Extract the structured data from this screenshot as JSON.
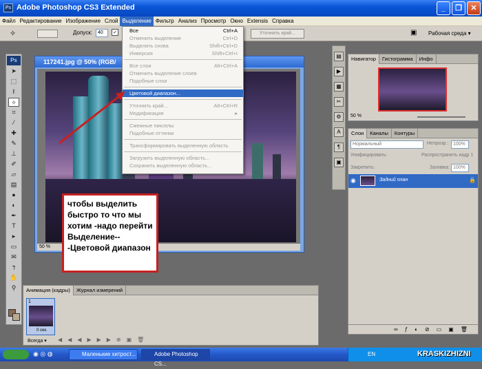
{
  "app": {
    "logo": "Ps",
    "title": "Adobe Photoshop CS3 Extended"
  },
  "menubar": [
    "Файл",
    "Редактирование",
    "Изображение",
    "Слой",
    "Выделение",
    "Фильтр",
    "Анализ",
    "Просмотр",
    "Окно",
    "Extensis",
    "Справка"
  ],
  "options": {
    "tolerance_label": "Допуск:",
    "tolerance_value": "40",
    "refine_edge": "Уточнить край...",
    "workspace_label": "Рабочая среда ▾"
  },
  "document": {
    "title": "117241.jpg @ 50% (RGB/",
    "zoom": "50 %"
  },
  "select_menu": [
    {
      "label": "Все",
      "shortcut": "Ctrl+A",
      "state": "normal"
    },
    {
      "label": "Отменить выделение",
      "shortcut": "Ctrl+D",
      "state": "disabled"
    },
    {
      "label": "Выделить снова",
      "shortcut": "Shift+Ctrl+D",
      "state": "disabled"
    },
    {
      "label": "Инверсия",
      "shortcut": "Shift+Ctrl+I",
      "state": "disabled"
    },
    {
      "sep": true
    },
    {
      "label": "Все слои",
      "shortcut": "Alt+Ctrl+A",
      "state": "disabled"
    },
    {
      "label": "Отменить выделение слоев",
      "shortcut": "",
      "state": "disabled"
    },
    {
      "label": "Подобные слои",
      "shortcut": "",
      "state": "disabled"
    },
    {
      "sep": true
    },
    {
      "label": "Цветовой диапазон...",
      "shortcut": "",
      "state": "highlighted"
    },
    {
      "sep": true
    },
    {
      "label": "Уточнить край...",
      "shortcut": "Alt+Ctrl+R",
      "state": "disabled"
    },
    {
      "label": "Модификация",
      "shortcut": "▸",
      "state": "disabled"
    },
    {
      "sep": true
    },
    {
      "label": "Смежные пикселы",
      "shortcut": "",
      "state": "disabled"
    },
    {
      "label": "Подобные оттенки",
      "shortcut": "",
      "state": "disabled"
    },
    {
      "sep": true
    },
    {
      "label": "Трансформировать выделенную область",
      "shortcut": "",
      "state": "disabled"
    },
    {
      "sep": true
    },
    {
      "label": "Загрузить выделенную область...",
      "shortcut": "",
      "state": "disabled"
    },
    {
      "label": "Сохранить выделенную область...",
      "shortcut": "",
      "state": "disabled"
    }
  ],
  "annotation": "чтобы выделить быстро то что мы хотим -надо перейти Выделение-- -Цветовой диапазон",
  "navigator": {
    "tabs": [
      "Навигатор",
      "Гистограмма",
      "Инфо"
    ],
    "zoom": "50 %"
  },
  "layers": {
    "tabs": [
      "Слои",
      "Каналы",
      "Контуры"
    ],
    "blend_mode": "Нормальный",
    "opacity_label": "Непрозр.:",
    "opacity_value": "100%",
    "unify_label": "Унифицировать:",
    "propagate_label": "Распространить кадр 1",
    "lock_label": "Закрепить:",
    "fill_label": "Заливка:",
    "fill_value": "100%",
    "layer_name": "Задний план"
  },
  "animation": {
    "tabs": [
      "Анимация (кадры)",
      "Журнал измерений"
    ],
    "frame_number": "1",
    "frame_delay": "0 сек.",
    "loop": "Всегда ▾"
  },
  "taskbar": {
    "item1": "Маленькие хитрост...",
    "item2": "Adobe Photoshop CS...",
    "lang": "EN",
    "watermark": "KRASKIZHIZNI"
  },
  "colors": {
    "accent": "#316ac5",
    "annotation_border": "#c82020",
    "arrow": "#c82020"
  }
}
